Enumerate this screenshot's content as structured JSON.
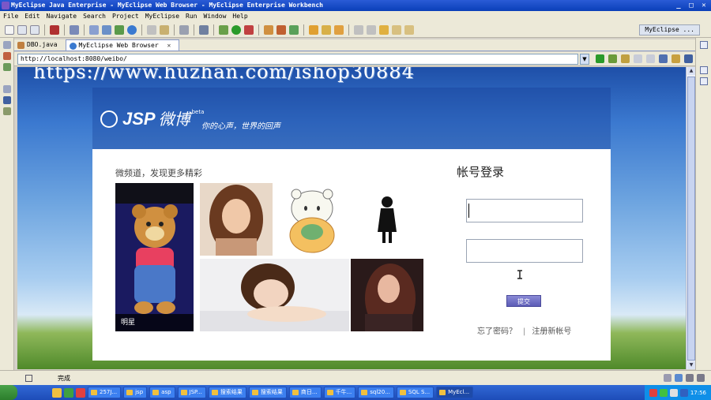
{
  "window": {
    "title": "MyEclipse Java Enterprise - MyEclipse Web Browser - MyEclipse Enterprise Workbench",
    "min_glyph": "_",
    "max_glyph": "□",
    "close_glyph": "✕"
  },
  "menu": [
    "File",
    "Edit",
    "Navigate",
    "Search",
    "Project",
    "MyEclipse",
    "Run",
    "Window",
    "Help"
  ],
  "perspective": {
    "label": "MyEclipse ..."
  },
  "editor_tabs": [
    {
      "label": "DBO.java",
      "active": false
    },
    {
      "label": "MyEclipse Web Browser",
      "active": true,
      "close": "✕"
    }
  ],
  "browser": {
    "url": "http://localhost:8080/weibo/",
    "dropdown": "▼"
  },
  "watermark": "https://www.huzhan.com/ishop30884",
  "site": {
    "logo_text": "JSP",
    "logo_cn": "微博",
    "beta": "beta",
    "slogan": "你的心声，世界的回声"
  },
  "discover": {
    "title": "微频道，发现更多精彩",
    "caption": "明星"
  },
  "login": {
    "title": "帐号登录",
    "username_value": "",
    "password_value": "",
    "submit": "提交",
    "forgot": "忘了密码？",
    "separator": "|",
    "register": "注册新帐号"
  },
  "status": {
    "text": "完成"
  },
  "taskbar": {
    "tasks": [
      "257J...",
      "jsp",
      "asp",
      "JSP...",
      "搜索结果",
      "搜索结果",
      "商日...",
      "千牛...",
      "sql20...",
      "SQL S...",
      "MyEcl..."
    ],
    "active_task": "MyEcl...",
    "clock": "17:56"
  },
  "colors": {
    "title_bar": "#0a3fb8",
    "chrome": "#ece9d8",
    "submit": "#6b6bc4",
    "sky_top": "#1e4fa8"
  }
}
